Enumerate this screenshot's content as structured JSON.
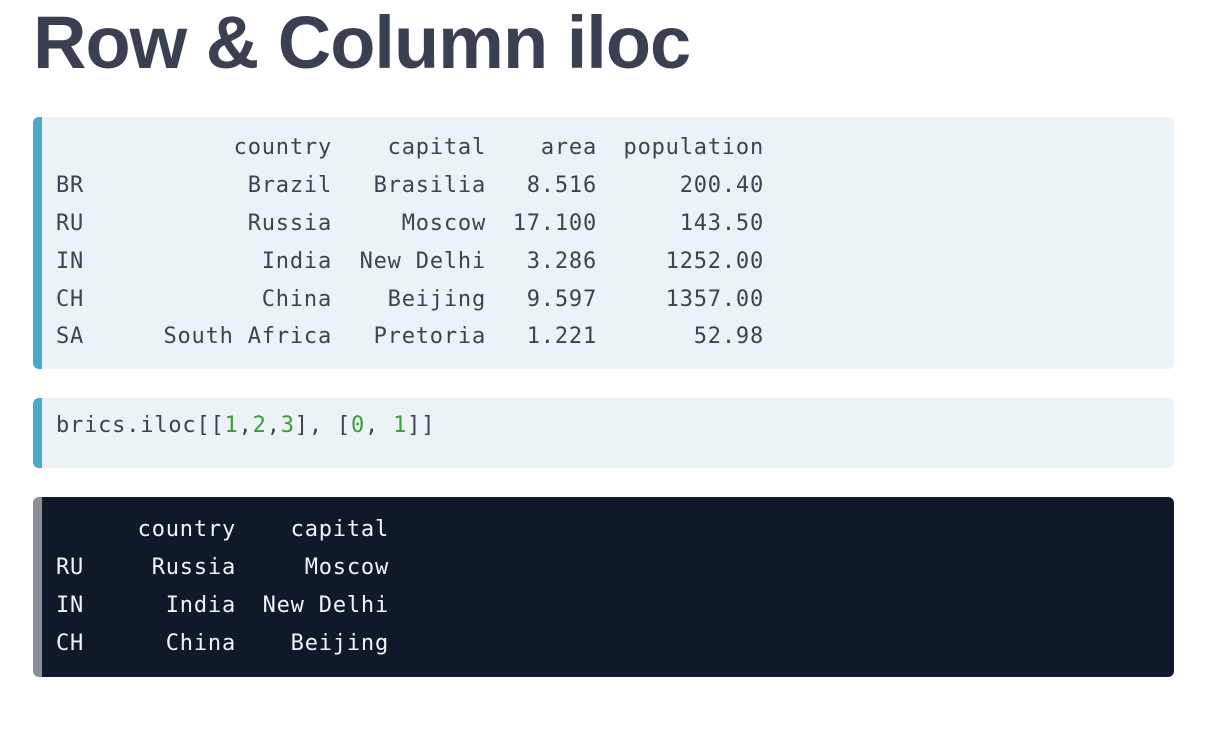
{
  "title": "Row & Column iloc",
  "dataframe": {
    "columns": [
      "country",
      "capital",
      "area",
      "population"
    ],
    "rows": [
      {
        "index": "BR",
        "country": "Brazil",
        "capital": "Brasilia",
        "area": "8.516",
        "population": "200.40"
      },
      {
        "index": "RU",
        "country": "Russia",
        "capital": "Moscow",
        "area": "17.100",
        "population": "143.50"
      },
      {
        "index": "IN",
        "country": "India",
        "capital": "New Delhi",
        "area": "3.286",
        "population": "1252.00"
      },
      {
        "index": "CH",
        "country": "China",
        "capital": "Beijing",
        "area": "9.597",
        "population": "1357.00"
      },
      {
        "index": "SA",
        "country": "South Africa",
        "capital": "Pretoria",
        "area": "1.221",
        "population": "52.98"
      }
    ]
  },
  "code": {
    "prefix": "brics.iloc[[",
    "rows": [
      "1",
      "2",
      "3"
    ],
    "middle": "], [",
    "cols": [
      "0",
      "1"
    ],
    "suffix": "]]"
  },
  "result": {
    "columns": [
      "country",
      "capital"
    ],
    "rows": [
      {
        "index": "RU",
        "country": "Russia",
        "capital": "Moscow"
      },
      {
        "index": "IN",
        "country": "India",
        "capital": "New Delhi"
      },
      {
        "index": "CH",
        "country": "China",
        "capital": "Beijing"
      }
    ]
  },
  "colors": {
    "title": "#3a4051",
    "light_block_bg": "#ebf3f7",
    "accent_bar": "#4aa8c9",
    "dark_block_bg": "#10192a",
    "dark_accent_bar": "#8a8f96",
    "number_literal": "#3e9a3e"
  }
}
